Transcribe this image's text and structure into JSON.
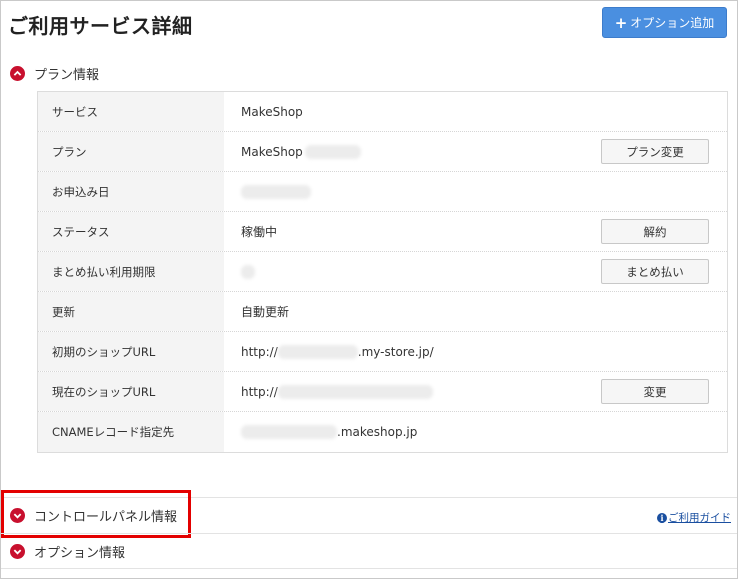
{
  "page_title": "ご利用サービス詳細",
  "add_option_button": "オプション追加",
  "sections": {
    "plan_info": "プラン情報",
    "control_panel_info": "コントロールパネル情報",
    "option_info": "オプション情報"
  },
  "guide_link": "ご利用ガイド",
  "plan_rows": [
    {
      "label": "サービス",
      "value": "MakeShop",
      "button": ""
    },
    {
      "label": "プラン",
      "value": "MakeShop",
      "button": "プラン変更"
    },
    {
      "label": "お申込み日",
      "value": "",
      "button": ""
    },
    {
      "label": "ステータス",
      "value": "稼働中",
      "button": "解約"
    },
    {
      "label": "まとめ払い利用期限",
      "value": "",
      "button": "まとめ払い"
    },
    {
      "label": "更新",
      "value": "自動更新",
      "button": ""
    },
    {
      "label": "初期のショップURL",
      "value": "http://",
      "value_suffix": ".my-store.jp/",
      "button": ""
    },
    {
      "label": "現在のショップURL",
      "value": "http://",
      "button": "変更"
    },
    {
      "label": "CNAMEレコード指定先",
      "value": "",
      "value_suffix": ".makeshop.jp",
      "button": ""
    }
  ],
  "colors": {
    "accent_red": "#c8102e",
    "button_blue": "#4a8fe0",
    "highlight_red": "#e30000",
    "link_blue": "#1a4fa0"
  }
}
